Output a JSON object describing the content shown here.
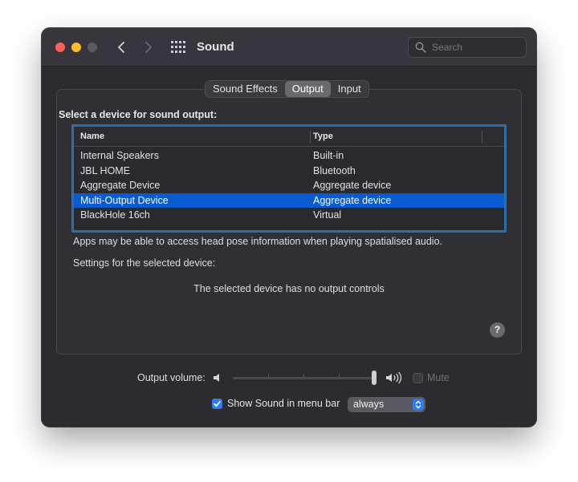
{
  "window": {
    "title": "Sound",
    "search_placeholder": "Search"
  },
  "tabs": [
    {
      "label": "Sound Effects",
      "active": false
    },
    {
      "label": "Output",
      "active": true
    },
    {
      "label": "Input",
      "active": false
    }
  ],
  "output": {
    "heading": "Select a device for sound output:",
    "columns": {
      "name": "Name",
      "type": "Type"
    },
    "devices": [
      {
        "name": "Internal Speakers",
        "type": "Built-in",
        "selected": false
      },
      {
        "name": "JBL HOME",
        "type": "Bluetooth",
        "selected": false
      },
      {
        "name": "Aggregate Device",
        "type": "Aggregate device",
        "selected": false
      },
      {
        "name": "Multi-Output Device",
        "type": "Aggregate device",
        "selected": true
      },
      {
        "name": "BlackHole 16ch",
        "type": "Virtual",
        "selected": false
      }
    ],
    "head_pose_note": "Apps may be able to access head pose information when playing spatialised audio.",
    "settings_label": "Settings for the selected device:",
    "no_controls": "The selected device has no output controls",
    "help_label": "?"
  },
  "volume": {
    "label": "Output volume:",
    "level": 1.0,
    "mute_label": "Mute",
    "muted": false
  },
  "menubar": {
    "show_label": "Show Sound in menu bar",
    "checked": true,
    "select_value": "always"
  },
  "colors": {
    "selection": "#0a5bd0",
    "accent": "#2f7cf6",
    "table_focus": "#2c6fa8"
  },
  "icons": {
    "back": "chevron-left-icon",
    "forward": "chevron-right-icon",
    "grid": "grid-icon",
    "search": "search-icon",
    "volume_low": "speaker-low-icon",
    "volume_high": "speaker-high-icon",
    "check": "checkmark-icon",
    "stepper": "up-down-chevron-icon",
    "help": "help-icon"
  }
}
